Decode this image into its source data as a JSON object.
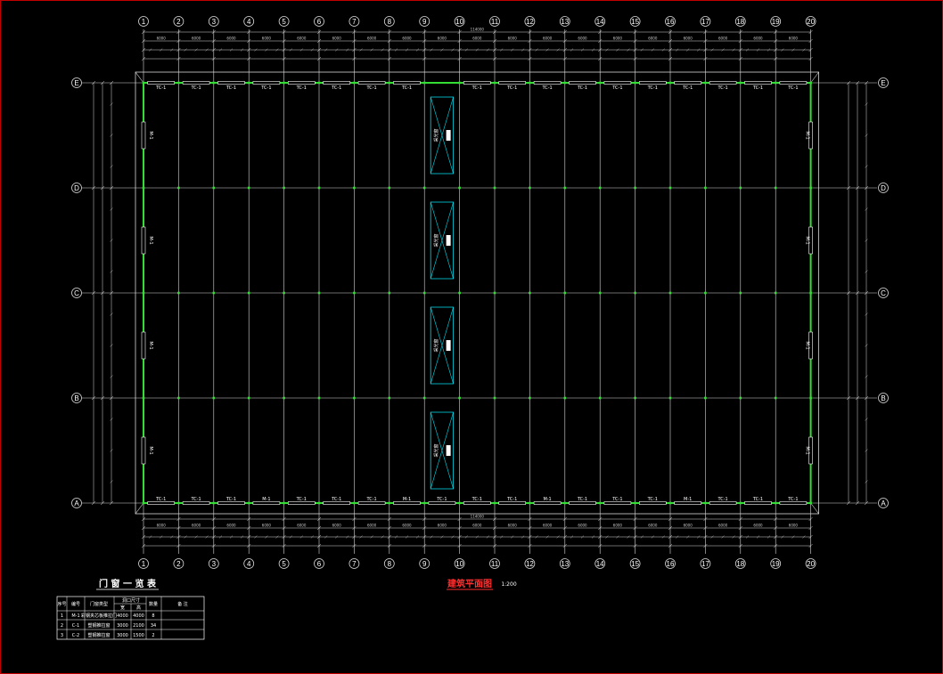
{
  "drawing": {
    "plan_title": "建筑平面图",
    "plan_scale": "1:200",
    "table_title": "门 窗 一 览 表",
    "col_axes": [
      "1",
      "2",
      "3",
      "4",
      "5",
      "6",
      "7",
      "8",
      "9",
      "10",
      "11",
      "12",
      "13",
      "14",
      "15",
      "16",
      "17",
      "18",
      "19",
      "20"
    ],
    "row_axes": [
      "E",
      "D",
      "C",
      "B",
      "A"
    ],
    "bay_dim": "6000",
    "total_length": "114000",
    "skylight_label": "采光窗",
    "top_opening_labels": [
      "TC-1",
      "TC-1",
      "TC-1",
      "TC-1",
      "TC-1",
      "TC-1",
      "TC-1",
      "TC-1",
      "TC-1",
      "TC-1",
      "TC-1",
      "TC-1",
      "TC-1",
      "TC-1",
      "TC-1",
      "TC-1",
      "TC-1",
      "TC-1"
    ],
    "bottom_opening_labels": [
      "TC-1",
      "TC-1",
      "TC-1",
      "M-1",
      "TC-1",
      "TC-1",
      "TC-1",
      "M-1",
      "TC-1",
      "TC-1",
      "TC-1",
      "M-1",
      "TC-1",
      "TC-1",
      "TC-1",
      "M-1",
      "TC-1",
      "TC-1",
      "TC-1"
    ],
    "side_door_label": "M-1"
  },
  "door_table": {
    "headers": [
      "序号",
      "编号",
      "门窗类型",
      "洞口尺寸",
      "数量",
      "备 注"
    ],
    "sub_headers": [
      "宽",
      "高"
    ],
    "rows": [
      [
        "1",
        "M-1",
        "彩钢夹芯板推拉门",
        "4000",
        "4000",
        "8",
        ""
      ],
      [
        "2",
        "C-1",
        "塑钢推拉窗",
        "3000",
        "2100",
        "34",
        ""
      ],
      [
        "3",
        "C-2",
        "塑钢推拉窗",
        "3000",
        "1500",
        "2",
        ""
      ]
    ]
  }
}
